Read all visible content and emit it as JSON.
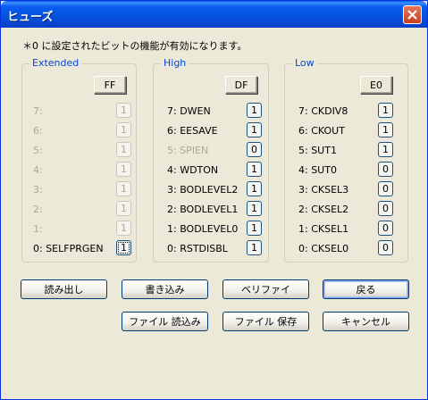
{
  "window": {
    "title": "ヒューズ"
  },
  "note": "＊0 に設定されたビットの機能が有効になります。",
  "extended": {
    "title": "Extended",
    "hex": "FF",
    "bits": [
      {
        "label": "7:",
        "value": "1"
      },
      {
        "label": "6:",
        "value": "1"
      },
      {
        "label": "5:",
        "value": "1"
      },
      {
        "label": "4:",
        "value": "1"
      },
      {
        "label": "3:",
        "value": "1"
      },
      {
        "label": "2:",
        "value": "1"
      },
      {
        "label": "1:",
        "value": "1"
      },
      {
        "label": "0: SELFPRGEN",
        "value": "1"
      }
    ]
  },
  "high": {
    "title": "High",
    "hex": "DF",
    "bits": [
      {
        "label": "7: DWEN",
        "value": "1"
      },
      {
        "label": "6: EESAVE",
        "value": "1"
      },
      {
        "label": "5: SPIEN",
        "value": "0"
      },
      {
        "label": "4: WDTON",
        "value": "1"
      },
      {
        "label": "3: BODLEVEL2",
        "value": "1"
      },
      {
        "label": "2: BODLEVEL1",
        "value": "1"
      },
      {
        "label": "1: BODLEVEL0",
        "value": "1"
      },
      {
        "label": "0: RSTDISBL",
        "value": "1"
      }
    ]
  },
  "low": {
    "title": "Low",
    "hex": "E0",
    "bits": [
      {
        "label": "7: CKDIV8",
        "value": "1"
      },
      {
        "label": "6: CKOUT",
        "value": "1"
      },
      {
        "label": "5: SUT1",
        "value": "1"
      },
      {
        "label": "4: SUT0",
        "value": "0"
      },
      {
        "label": "3: CKSEL3",
        "value": "0"
      },
      {
        "label": "2: CKSEL2",
        "value": "0"
      },
      {
        "label": "1: CKSEL1",
        "value": "0"
      },
      {
        "label": "0: CKSEL0",
        "value": "0"
      }
    ]
  },
  "buttons": {
    "read": "読み出し",
    "write": "書き込み",
    "verify": "ベリファイ",
    "back": "戻る",
    "file_load": "ファイル 読込み",
    "file_save": "ファイル 保存",
    "cancel": "キャンセル"
  }
}
